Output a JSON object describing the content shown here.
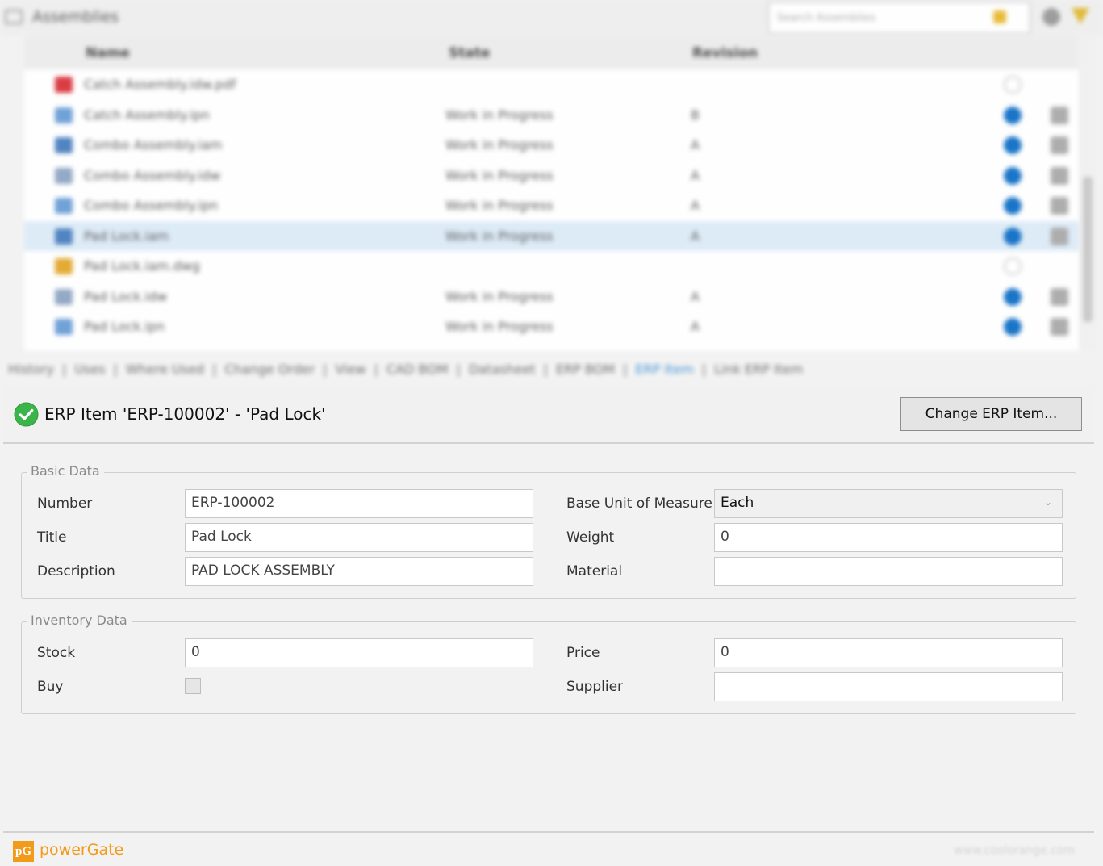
{
  "window": {
    "title": "Assemblies",
    "search_placeholder": "Search Assemblies"
  },
  "grid": {
    "columns": [
      "Name",
      "State",
      "Revision"
    ],
    "rows": [
      {
        "name": "Catch Assembly.idw.pdf",
        "state": "",
        "revision": "",
        "icon_color": "#d9333b",
        "status": "empty"
      },
      {
        "name": "Catch Assembly.ipn",
        "state": "Work in Progress",
        "revision": "B",
        "icon_color": "#6a9ed6",
        "status": "blue"
      },
      {
        "name": "Combo Assembly.iam",
        "state": "Work in Progress",
        "revision": "A",
        "icon_color": "#4a7fc0",
        "status": "blue"
      },
      {
        "name": "Combo Assembly.idw",
        "state": "Work in Progress",
        "revision": "A",
        "icon_color": "#8fa6c4",
        "status": "blue"
      },
      {
        "name": "Combo Assembly.ipn",
        "state": "Work in Progress",
        "revision": "A",
        "icon_color": "#6a9ed6",
        "status": "blue"
      },
      {
        "name": "Pad Lock.iam",
        "state": "Work in Progress",
        "revision": "A",
        "icon_color": "#4a7fc0",
        "status": "blue",
        "selected": true
      },
      {
        "name": "Pad Lock.iam.dwg",
        "state": "",
        "revision": "",
        "icon_color": "#e2a82c",
        "status": "empty"
      },
      {
        "name": "Pad Lock.idw",
        "state": "Work in Progress",
        "revision": "A",
        "icon_color": "#8fa6c4",
        "status": "blue"
      },
      {
        "name": "Pad Lock.ipn",
        "state": "Work in Progress",
        "revision": "A",
        "icon_color": "#6a9ed6",
        "status": "blue"
      }
    ]
  },
  "tabs": [
    "History",
    "Uses",
    "Where Used",
    "Change Order",
    "View",
    "CAD BOM",
    "Datasheet",
    "ERP BOM",
    "ERP Item",
    "Link ERP Item"
  ],
  "active_tab": "ERP Item",
  "erp": {
    "title": "ERP Item 'ERP-100002' - 'Pad Lock'",
    "change_button": "Change ERP Item..."
  },
  "basic_data": {
    "legend": "Basic Data",
    "number_label": "Number",
    "number_value": "ERP-100002",
    "title_label": "Title",
    "title_value": "Pad Lock",
    "description_label": "Description",
    "description_value": "PAD LOCK ASSEMBLY",
    "unit_label": "Base Unit of Measure",
    "unit_value": "Each",
    "weight_label": "Weight",
    "weight_value": "0",
    "material_label": "Material",
    "material_value": ""
  },
  "inventory_data": {
    "legend": "Inventory Data",
    "stock_label": "Stock",
    "stock_value": "0",
    "buy_label": "Buy",
    "buy_checked": false,
    "price_label": "Price",
    "price_value": "0",
    "supplier_label": "Supplier",
    "supplier_value": ""
  },
  "footer": {
    "logo_text": "pG",
    "brand": "powerGate",
    "site": "www.coolorange.com"
  },
  "colors": {
    "accent_orange": "#f29a1a",
    "status_blue": "#0f6fc6",
    "success_green": "#3bb54a",
    "active_tab_blue": "#3a8fd6"
  }
}
